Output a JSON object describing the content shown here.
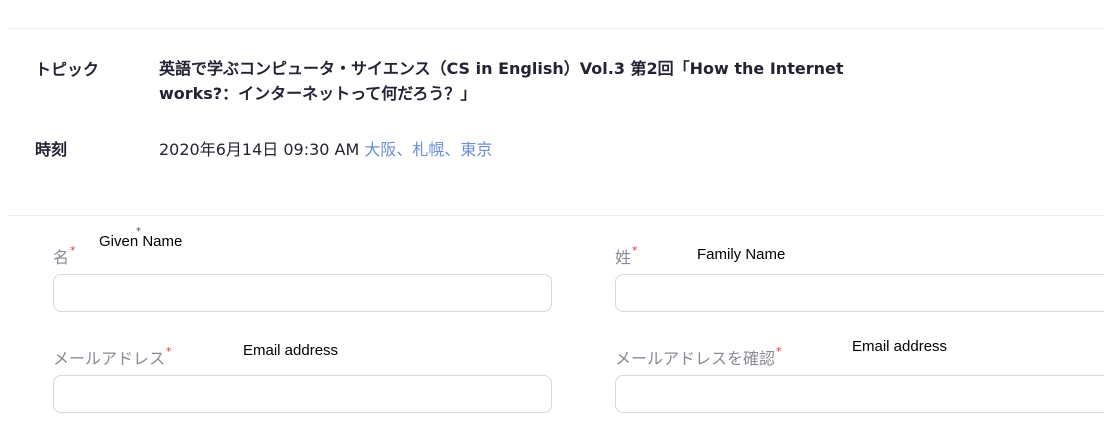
{
  "meeting": {
    "topic_label": "トピック",
    "topic_value": "英語で学ぶコンピュータ・サイエンス（CS in English）Vol.3 第2回「How the Internet works?：インターネットって何だろう？」",
    "time_label": "時刻",
    "time_value": "2020年6月14日 09:30 AM",
    "time_zone": "大阪、札幌、東京"
  },
  "form": {
    "first_name_label": "名",
    "last_name_label": "姓",
    "email_label": "メールアドレス",
    "email_confirm_label": "メールアドレスを確認",
    "required_mark": "*"
  },
  "annotations": {
    "given_name": "Given Name",
    "family_name": "Family Name",
    "email_address": "Email address",
    "email_address_confirm": "Email address",
    "star": "*"
  },
  "colors": {
    "link": "#6c8fd8",
    "required": "#e0393e",
    "label_gray": "#8a8a96",
    "input_border": "#d8d8de"
  }
}
